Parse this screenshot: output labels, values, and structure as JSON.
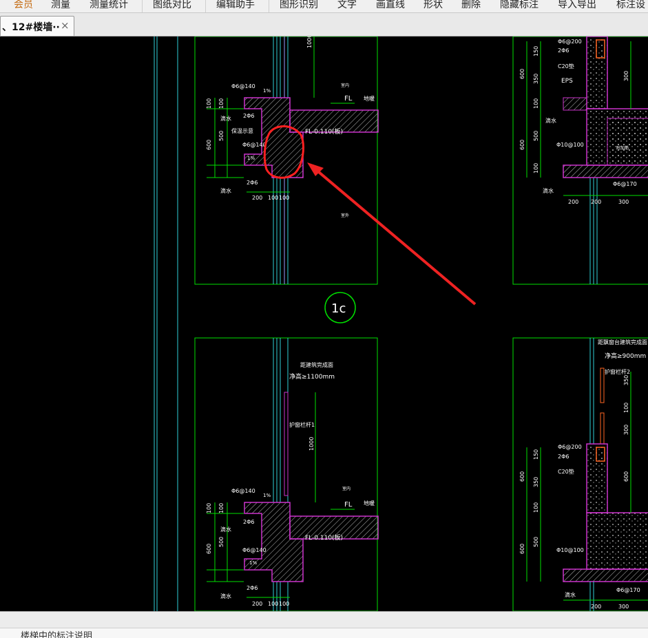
{
  "menu": {
    "items": [
      "会员",
      "测量",
      "测量统计",
      "图纸对比",
      "编辑助手",
      "图形识别",
      "文字",
      "画直线",
      "形状",
      "删除",
      "隐藏标注",
      "导入导出",
      "标注设"
    ]
  },
  "tab": {
    "title": "、12#楼墙··",
    "close_label": "×"
  },
  "drawing": {
    "detail_label": "1c",
    "fl": "FL",
    "floor_level": "FL-0.110(板)",
    "floor_label": "地暖",
    "indoor": "室内",
    "outdoor": "室外",
    "rebar_a": "Φ6@140",
    "rebar_b": "2Φ6",
    "slope": "1%",
    "drip": "滴水",
    "insulation": "保温示意",
    "dims_v": [
      "100",
      "100",
      "500",
      "600"
    ],
    "dims_h": [
      "200",
      "100",
      "100"
    ],
    "height_1000": "1000",
    "rail_top": "距建筑完成面",
    "rail_height": "净高≥1100mm",
    "rail_label": "护窗栏杆1",
    "right_rebar_a": "Φ6@200",
    "right_rebar_b": "2Φ6",
    "right_c20": "C20垫",
    "right_eps": "EPS",
    "right_rebar_c": "Φ10@100",
    "right_rebar_d": "Φ6@170",
    "right_drip": "滴水",
    "right_rail_top": "距飘窗台建筑完成面",
    "right_rail_height": "净高≥900mm",
    "right_rail_label": "护窗栏杆2",
    "right_dims_v": [
      "150",
      "350",
      "100",
      "500",
      "100",
      "600",
      "600"
    ],
    "right_dims_h": [
      "200",
      "200",
      "300"
    ],
    "right_misc": "附加筋",
    "right_dim_300": "300",
    "right_dim_100": "100"
  },
  "status": {
    "text": "楼梯中的标注说明"
  }
}
